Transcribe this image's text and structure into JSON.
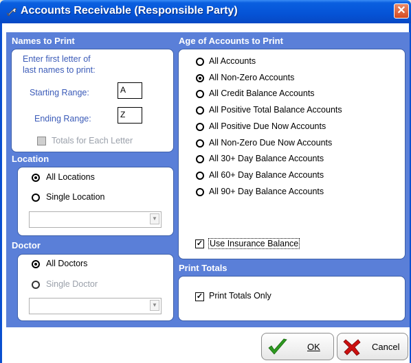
{
  "window": {
    "title": "Accounts Receivable (Responsible Party)",
    "close_glyph": "✕"
  },
  "names": {
    "header": "Names to Print",
    "instruction_line1": "Enter first letter of",
    "instruction_line2": "last names to print:",
    "starting_label": "Starting Range:",
    "starting_value": "A",
    "ending_label": "Ending Range:",
    "ending_value": "Z",
    "totals_each_letter": "Totals for Each Letter"
  },
  "location": {
    "header": "Location",
    "all_locations": "All Locations",
    "single_location": "Single Location",
    "selected": "All Locations"
  },
  "doctor": {
    "header": "Doctor",
    "all_doctors": "All Doctors",
    "single_doctor": "Single Doctor",
    "selected": "All Doctors"
  },
  "age": {
    "header": "Age of Accounts to Print",
    "options": [
      "All Accounts",
      "All Non-Zero Accounts",
      "All Credit Balance Accounts",
      "All Positive Total Balance Accounts",
      "All Positive Due Now Accounts",
      "All Non-Zero Due Now Accounts",
      "All 30+ Day Balance Accounts",
      "All 60+ Day Balance Accounts",
      "All 90+ Day Balance Accounts"
    ],
    "selected_index": 1,
    "use_insurance_balance": "Use Insurance Balance",
    "use_insurance_checked": true
  },
  "print_totals": {
    "header": "Print Totals",
    "only_label": "Print Totals Only",
    "only_checked": true
  },
  "buttons": {
    "ok": "OK",
    "cancel": "Cancel"
  },
  "icons": {
    "title": "wrench-icon",
    "ok": "checkmark-icon",
    "cancel": "x-icon"
  },
  "colors": {
    "accent": "#5a7fd8",
    "title_bar": "#0553d6",
    "close": "#d64a20",
    "ok_check": "#2e9a20",
    "cancel_x": "#cc1010"
  }
}
